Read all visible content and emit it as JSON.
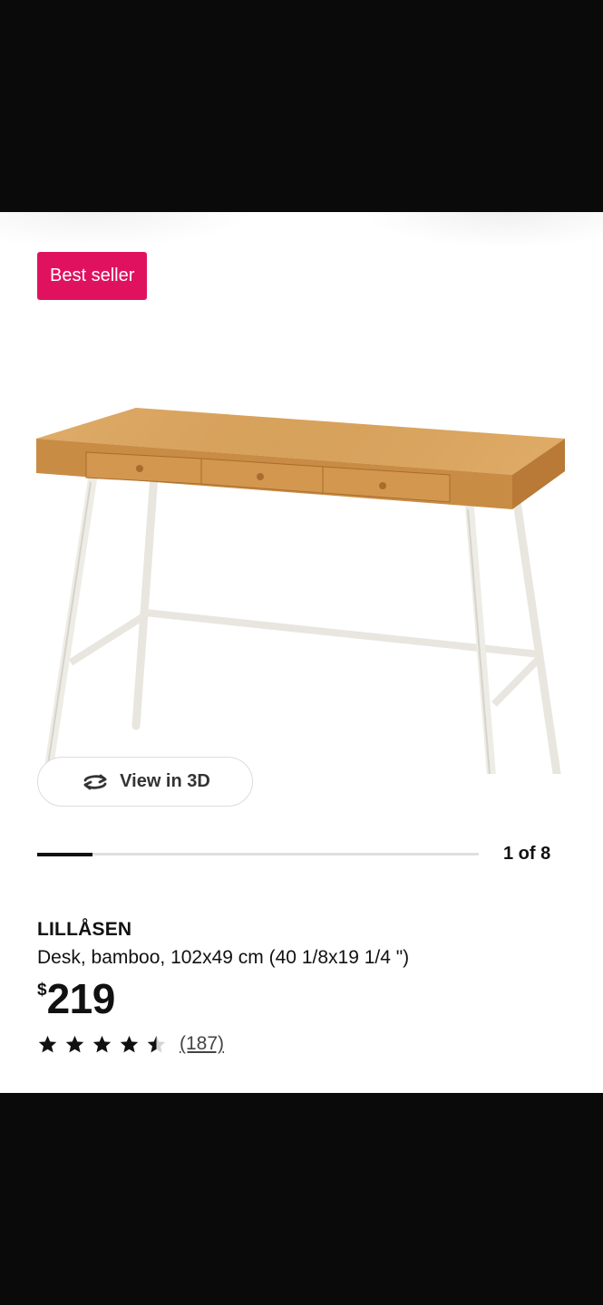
{
  "badge": {
    "label": "Best seller",
    "color": "#e0125f"
  },
  "product_image": {
    "alt": "Desk",
    "icon": "desk-image"
  },
  "view3d": {
    "label": "View in 3D",
    "icon": "rotate-icon"
  },
  "gallery": {
    "indicator": "1 of 8",
    "progress": 0.125
  },
  "product": {
    "name": "LILLÅSEN",
    "description": "Desk, bamboo, 102x49 cm (40 1/8x19 1/4 \")",
    "currency": "$",
    "price": "219"
  },
  "rating": {
    "value": 4.5,
    "max": 5,
    "count_label": "(187)"
  }
}
